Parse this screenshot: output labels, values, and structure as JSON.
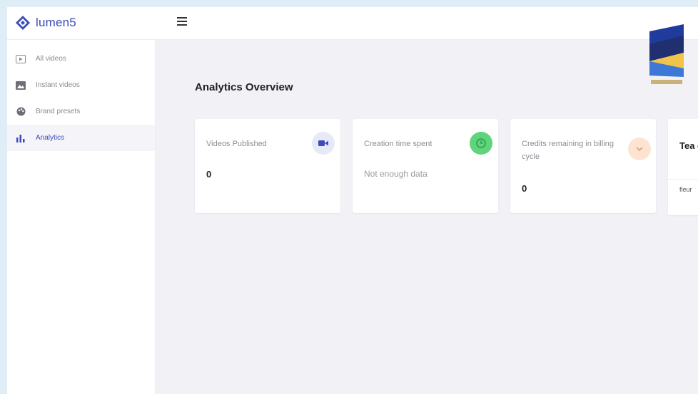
{
  "app": {
    "name": "lumen5"
  },
  "sidebar": {
    "items": [
      {
        "label": "All videos",
        "icon": "play-square-icon"
      },
      {
        "label": "Instant videos",
        "icon": "image-icon"
      },
      {
        "label": "Brand presets",
        "icon": "palette-icon"
      },
      {
        "label": "Analytics",
        "icon": "bar-chart-icon",
        "active": true
      }
    ]
  },
  "main": {
    "title": "Analytics Overview",
    "cards": [
      {
        "title": "Videos Published",
        "value": "0",
        "icon": "video-camera-icon",
        "badge_color": "#e6e9f8"
      },
      {
        "title": "Creation time spent",
        "note": "Not enough data",
        "icon": "clock-icon",
        "badge_color": "#5ed47b"
      },
      {
        "title": "Credits remaining in billing cycle",
        "value": "0",
        "icon": "chevron-down-icon",
        "badge_color": "#fde4d2"
      }
    ],
    "partial_card": {
      "title": "Tea cou",
      "subtitle": "fleur"
    }
  },
  "colors": {
    "accent": "#3d4bb8",
    "background": "#f1f1f6"
  }
}
